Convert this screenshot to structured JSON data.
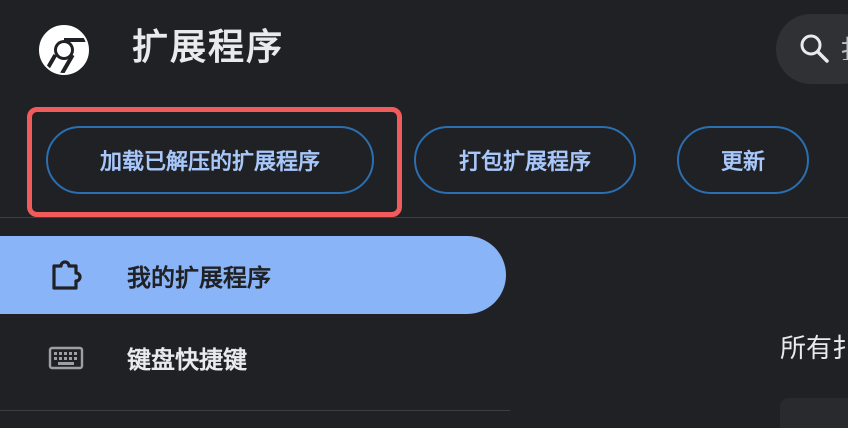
{
  "header": {
    "title": "扩展程序",
    "logo_icon": "chrome-logo-icon",
    "search_icon": "search-icon",
    "search_partial_text": "扌"
  },
  "toolbar": {
    "load_unpacked_label": "加载已解压的扩展程序",
    "pack_label": "打包扩展程序",
    "update_label": "更新",
    "highlight_color": "#f25b5b",
    "button_text_color": "#a8c7fa",
    "button_border_color": "#2a6fb0"
  },
  "sidebar": {
    "items": [
      {
        "label": "我的扩展程序",
        "icon": "puzzle-piece-icon",
        "active": true
      },
      {
        "label": "键盘快捷键",
        "icon": "keyboard-icon",
        "active": false
      }
    ],
    "active_color": "#8ab4f8"
  },
  "main": {
    "heading_partial": "所有扌"
  },
  "colors": {
    "background": "#202124",
    "text": "#e8eaed"
  }
}
